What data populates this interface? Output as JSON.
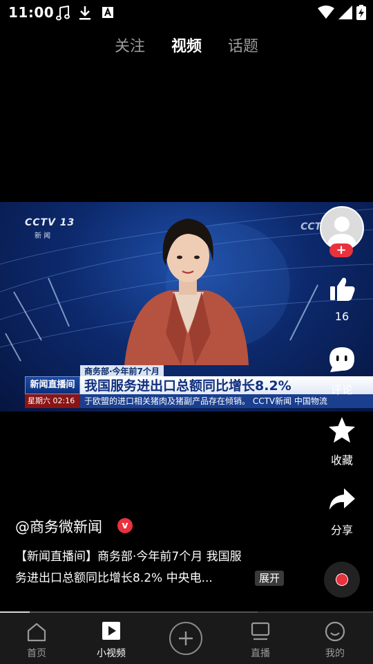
{
  "status_bar": {
    "time": "11:00",
    "left_icons": [
      "music-note-icon",
      "download-icon",
      "font-a-icon"
    ],
    "right_icons": [
      "wifi-icon",
      "signal-icon",
      "battery-charging-icon"
    ]
  },
  "top_tabs": [
    {
      "label": "关注",
      "active": false
    },
    {
      "label": "视频",
      "active": true
    },
    {
      "label": "话题",
      "active": false
    }
  ],
  "video": {
    "channel_logo": "CCTV 13",
    "channel_sub": "新 闻",
    "channel_logo_right": "CCTV",
    "lower_third_top": "商务部·今年前7个月",
    "program_badge": "新闻直播间",
    "headline": "我国服务进出口总额同比增长8.2%",
    "date_bar": "星期六 02:16",
    "ticker": "于欧盟的进口相关猪肉及猪副产品存在倾销。  CCTV新闻  中国物流"
  },
  "actions": {
    "like_count": "16",
    "comment_label": "评论",
    "favorite_label": "收藏",
    "share_label": "分享",
    "follow_symbol": "+"
  },
  "post": {
    "author": "@商务微新闻",
    "verified_symbol": "v",
    "caption_line1": "【新闻直播间】商务部·今年前7个月 我国服",
    "caption_line2": "务进出口总额同比增长8.2%  中央电...",
    "expand_label": "展开"
  },
  "progress": {
    "fraction": 0.08,
    "buffered": 0.69
  },
  "bottom_nav": [
    {
      "label": "首页",
      "icon": "home-icon",
      "active": false
    },
    {
      "label": "小视频",
      "icon": "play-square-icon",
      "active": true
    },
    {
      "label": "直播",
      "icon": "tv-icon",
      "active": false
    },
    {
      "label": "我的",
      "icon": "smiley-profile-icon",
      "active": false
    }
  ],
  "colors": {
    "accent_red": "#e8323c",
    "nav_bg": "#1a1a1a",
    "inactive_text": "#9a9a9a"
  }
}
